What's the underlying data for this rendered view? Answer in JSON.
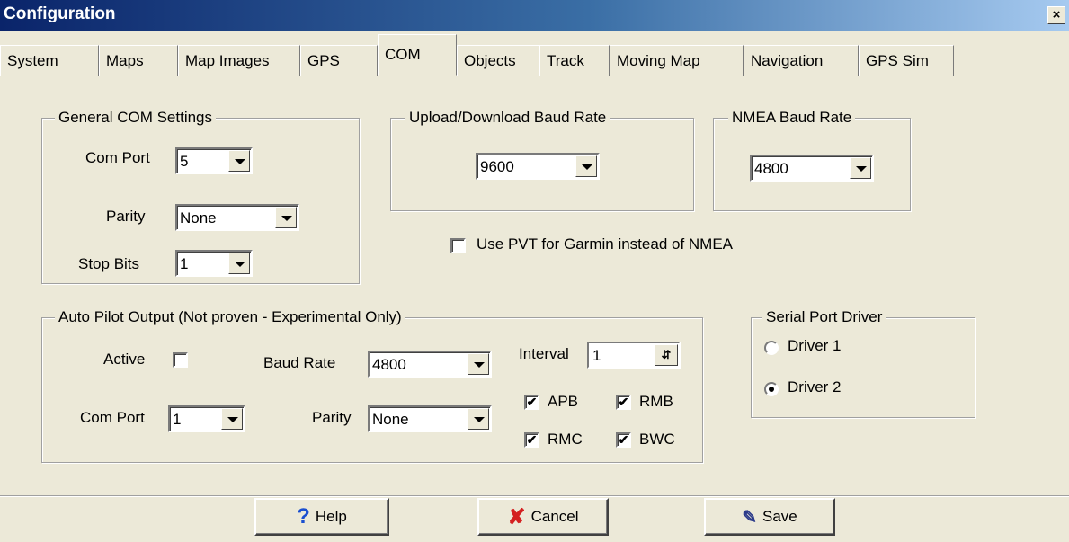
{
  "window": {
    "title": "Configuration",
    "close_glyph": "×"
  },
  "tabs": [
    "System",
    "Maps",
    "Map Images",
    "GPS",
    "COM",
    "Objects",
    "Track",
    "Moving Map",
    "Navigation",
    "GPS Sim"
  ],
  "active_tab": "COM",
  "general_com": {
    "legend": "General COM Settings",
    "com_port_label": "Com Port",
    "com_port_value": "5",
    "parity_label": "Parity",
    "parity_value": "None",
    "stop_bits_label": "Stop Bits",
    "stop_bits_value": "1"
  },
  "upload_baud": {
    "legend": "Upload/Download Baud Rate",
    "value": "9600"
  },
  "nmea_baud": {
    "legend": "NMEA Baud Rate",
    "value": "4800"
  },
  "use_pvt": {
    "label": "Use PVT for Garmin instead of NMEA",
    "checked": false
  },
  "autopilot": {
    "legend": "Auto Pilot Output  (Not proven - Experimental Only)",
    "active_label": "Active",
    "active_checked": false,
    "baud_label": "Baud Rate",
    "baud_value": "4800",
    "interval_label": "Interval",
    "interval_value": "1",
    "com_port_label": "Com Port",
    "com_port_value": "1",
    "parity_label": "Parity",
    "parity_value": "None",
    "sentences": {
      "apb": "APB",
      "rmb": "RMB",
      "rmc": "RMC",
      "bwc": "BWC"
    },
    "check_glyph": "✔"
  },
  "serial_driver": {
    "legend": "Serial Port Driver",
    "driver1": "Driver 1",
    "driver2": "Driver 2",
    "selected": "Driver 2"
  },
  "buttons": {
    "help": "Help",
    "cancel": "Cancel",
    "save": "Save",
    "help_icon": "?",
    "cancel_icon": "✘",
    "save_icon": "✎"
  },
  "colors": {
    "help_icon": "#1a4fd0",
    "cancel_icon": "#d42020",
    "save_icon": "#2b3a8a"
  }
}
